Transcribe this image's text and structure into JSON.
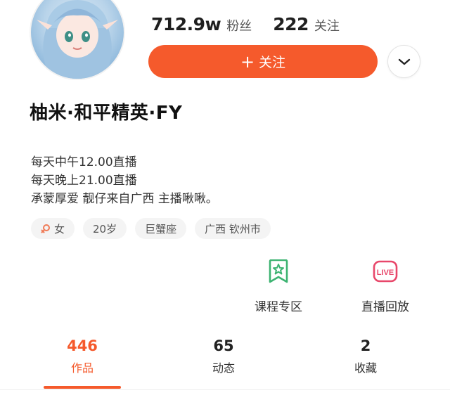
{
  "profile": {
    "followers_count": "712.9w",
    "followers_label": "粉丝",
    "following_count": "222",
    "following_label": "关注",
    "follow_button_label": "关注",
    "name": "柚米·和平精英·FY"
  },
  "bio": [
    "每天中午12.00直播",
    "每天晚上21.00直播",
    "承蒙厚爱 靓仔来自广西 主播啾啾。"
  ],
  "tags": {
    "gender": "女",
    "age": "20岁",
    "zodiac": "巨蟹座",
    "location": "广西 钦州市"
  },
  "features": {
    "course_label": "课程专区",
    "live_label": "直播回放",
    "live_icon_text": "LIVE"
  },
  "tabs": [
    {
      "count": "446",
      "label": "作品"
    },
    {
      "count": "65",
      "label": "动态"
    },
    {
      "count": "2",
      "label": "收藏"
    }
  ],
  "colors": {
    "accent": "#f55a2c",
    "course_icon": "#3cb371",
    "live_icon": "#e8476a",
    "gender_icon": "#f07a56"
  },
  "icons": {
    "follow": "plus-icon",
    "more": "chevron-down-icon",
    "gender": "female-icon",
    "course": "bookmark-star-icon",
    "live": "live-replay-icon"
  }
}
